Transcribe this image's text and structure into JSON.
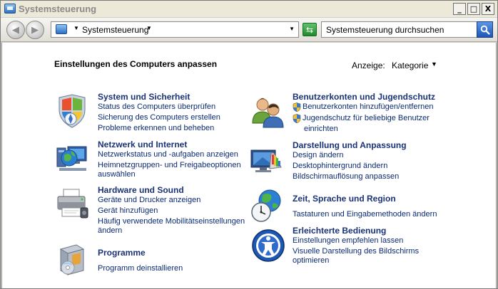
{
  "window": {
    "title": "Systemsteuerung"
  },
  "window_buttons": {
    "minimize": "_",
    "maximize": "□",
    "close": "X"
  },
  "address_bar": {
    "path": "Systemsteuerung"
  },
  "search": {
    "placeholder": "Systemsteuerung durchsuchen"
  },
  "main": {
    "heading": "Einstellungen des Computers anpassen",
    "view_label": "Anzeige:",
    "view_value": "Kategorie"
  },
  "categories": [
    {
      "icon": "shield-windows-icon",
      "title": "System und Sicherheit",
      "links": [
        "Status des Computers überprüfen",
        "Sicherung des Computers erstellen",
        "Probleme erkennen und beheben"
      ]
    },
    {
      "icon": "network-globe-icon",
      "title": "Netzwerk und Internet",
      "links": [
        "Netzwerkstatus und -aufgaben anzeigen",
        "Heimnetzgruppen- und Freigabeoptionen",
        "auswählen"
      ]
    },
    {
      "icon": "printer-icon",
      "title": "Hardware und Sound",
      "links": [
        "Geräte und Drucker anzeigen",
        "Gerät hinzufügen",
        "Häufig verwendete Mobilitätseinstellungen",
        "ändern"
      ]
    },
    {
      "icon": "programs-box-icon",
      "title": "Programme",
      "links": [
        "Programm deinstallieren"
      ]
    },
    {
      "icon": "users-icon",
      "title": "Benutzerkonten und Jugendschutz",
      "links": [
        "Benutzerkonten hinzufügen/entfernen",
        "Jugendschutz für beliebige Benutzer",
        "einrichten"
      ]
    },
    {
      "icon": "display-palette-icon",
      "title": "Darstellung und Anpassung",
      "links": [
        "Design ändern",
        "Desktophintergrund ändern",
        "Bildschirmauflösung anpassen"
      ]
    },
    {
      "icon": "globe-clock-icon",
      "title": "Zeit, Sprache und Region",
      "links": [
        "Tastaturen und Eingabemethoden ändern"
      ]
    },
    {
      "icon": "ease-of-access-icon",
      "title": "Erleichterte Bedienung",
      "links": [
        "Einstellungen empfehlen lassen",
        "Visuelle Darstellung des Bildschirms",
        "optimieren"
      ]
    }
  ]
}
